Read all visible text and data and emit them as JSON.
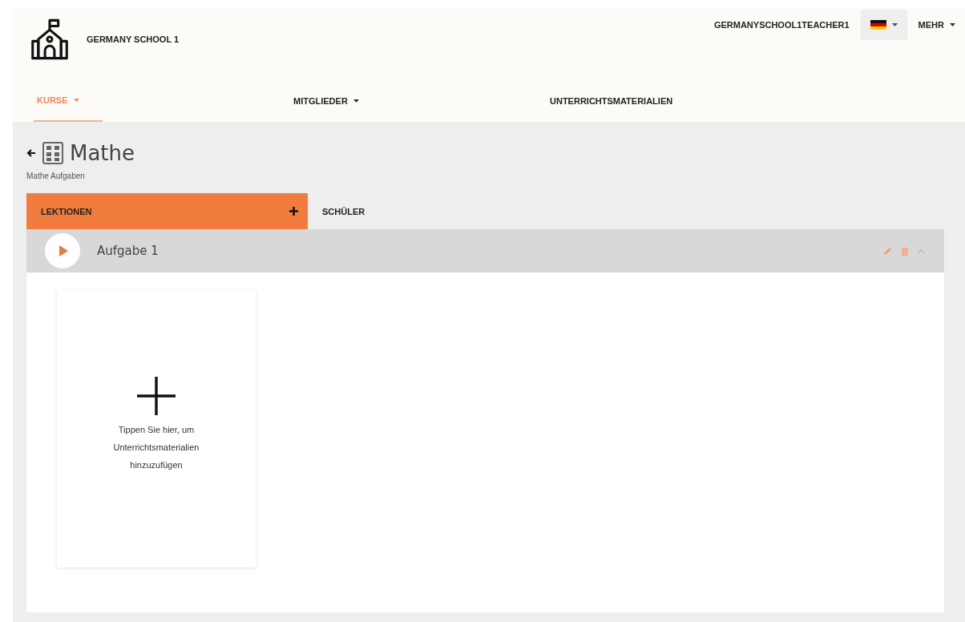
{
  "header": {
    "school_name": "GERMANY SCHOOL 1",
    "user": "GERMANYSCHOOL1TEACHER1",
    "more": "MEHR"
  },
  "nav": [
    {
      "label": "KURSE",
      "selected": true,
      "dropdown": true
    },
    {
      "label": "MITGLIEDER",
      "selected": false,
      "dropdown": true
    },
    {
      "label": "UNTERRICHTSMATERIALIEN",
      "selected": false,
      "dropdown": false
    }
  ],
  "course": {
    "title": "Mathe",
    "subtitle": "Mathe Aufgaben"
  },
  "tabs": [
    {
      "label": "LEKTIONEN",
      "selected": true
    },
    {
      "label": "SCHÜLER",
      "selected": false
    }
  ],
  "lessons": [
    {
      "title": "Aufgabe 1",
      "expanded": true,
      "add_card": "Tippen Sie hier, um Unterrichtsmaterialien hinzuzufügen"
    }
  ]
}
